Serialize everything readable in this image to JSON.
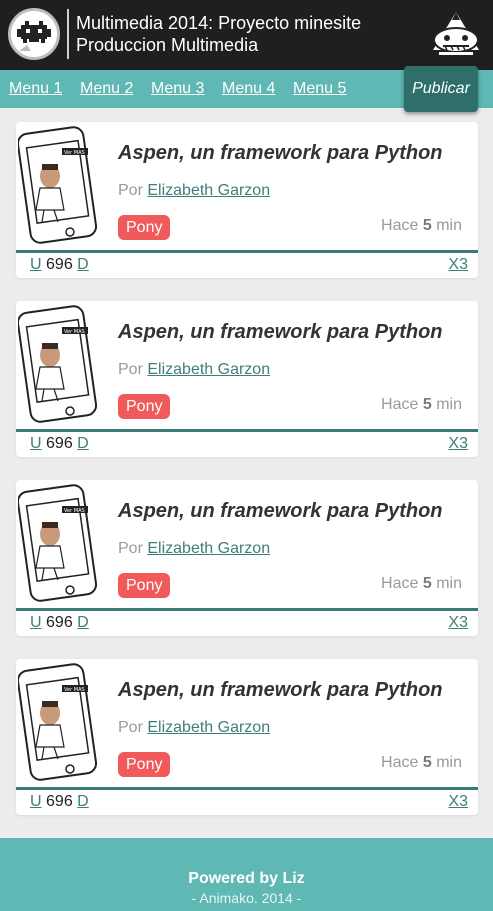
{
  "header": {
    "title_line1": "Multimedia 2014: Proyecto minesite",
    "title_line2": "Produccion Multimedia"
  },
  "nav": {
    "items": [
      "Menu 1",
      "Menu 2",
      "Menu 3",
      "Menu 4",
      "Menu 5"
    ],
    "publish_label": "Publicar"
  },
  "posts": [
    {
      "title": "Aspen, un framework para Python",
      "by_prefix": "Por",
      "author": "Elizabeth Garzon",
      "tag": "Pony",
      "time_prefix": "Hace",
      "time_value": "5",
      "time_unit": "min",
      "up": "U",
      "score": "696",
      "down": "D",
      "share": "X3",
      "thumb_label": "Ver MAS"
    },
    {
      "title": "Aspen, un framework para Python",
      "by_prefix": "Por",
      "author": "Elizabeth Garzon",
      "tag": "Pony",
      "time_prefix": "Hace",
      "time_value": "5",
      "time_unit": "min",
      "up": "U",
      "score": "696",
      "down": "D",
      "share": "X3",
      "thumb_label": "Ver MAS"
    },
    {
      "title": "Aspen, un framework para Python",
      "by_prefix": "Por",
      "author": "Elizabeth Garzon",
      "tag": "Pony",
      "time_prefix": "Hace",
      "time_value": "5",
      "time_unit": "min",
      "up": "U",
      "score": "696",
      "down": "D",
      "share": "X3",
      "thumb_label": "Ver MAS"
    },
    {
      "title": "Aspen, un framework para Python",
      "by_prefix": "Por",
      "author": "Elizabeth Garzon",
      "tag": "Pony",
      "time_prefix": "Hace",
      "time_value": "5",
      "time_unit": "min",
      "up": "U",
      "score": "696",
      "down": "D",
      "share": "X3",
      "thumb_label": "Ver MAS"
    }
  ],
  "footer": {
    "powered": "Powered by Liz",
    "copyright": "- Animako. 2014 -"
  },
  "colors": {
    "header_bg": "#1f1f1f",
    "accent_teal": "#5fb8b4",
    "dark_teal": "#2f6f6a",
    "tag_red": "#f05a5a"
  }
}
